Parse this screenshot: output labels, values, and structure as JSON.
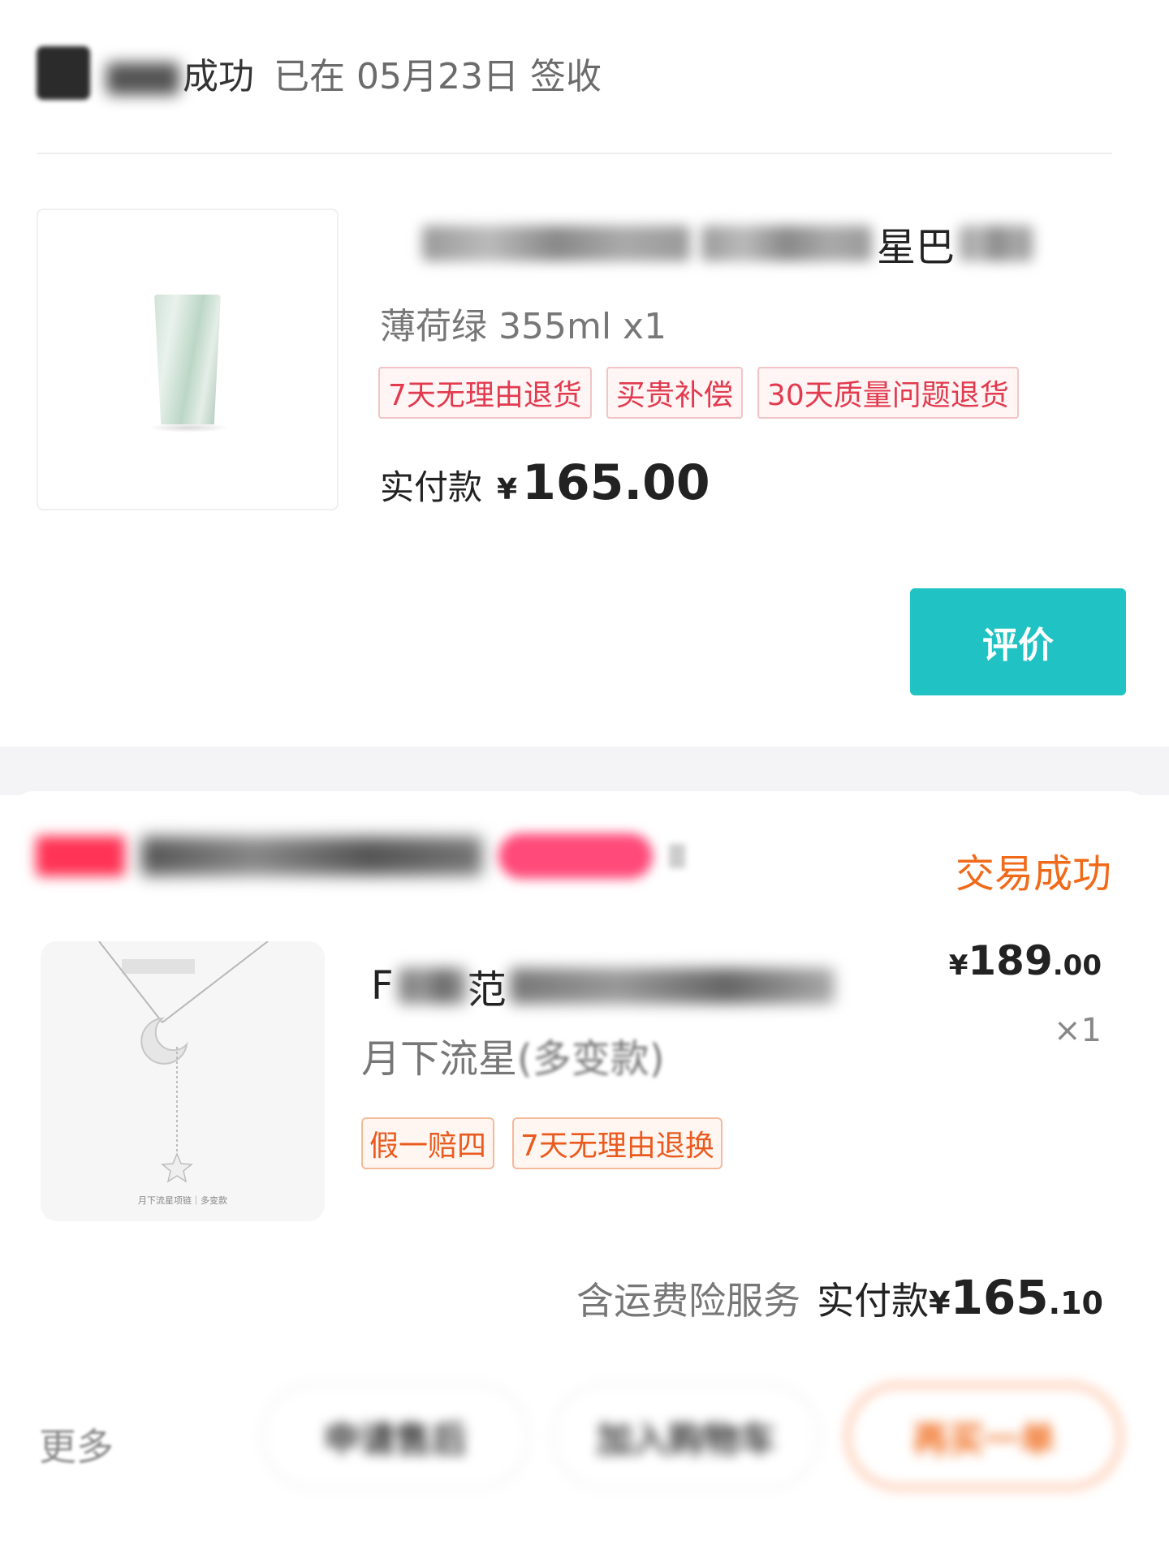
{
  "order1": {
    "status_blurred": "交易",
    "status": "成功",
    "sign_text": "已在 05月23日 签收",
    "title_visible": "星巴",
    "spec": "薄荷绿 355ml x1",
    "tags": [
      "7天无理由退货",
      "买贵补偿",
      "30天质量问题退货"
    ],
    "paid_label": "实付款",
    "currency": "¥",
    "paid_amount": "165.00",
    "review_button": "评价"
  },
  "order2": {
    "status": "交易成功",
    "title_visible_a": "F",
    "title_visible_b": "范",
    "price_currency": "¥",
    "price_int": "189",
    "price_dec": ".00",
    "qty": "×1",
    "spec_a": "月下流星",
    "spec_b": "(多变款)",
    "tags": [
      "假一赔四",
      "7天无理由退换"
    ],
    "thumb_caption": "月下流星项链｜多变款",
    "insurance_text": "含运费险服务",
    "paid_label": "实付款",
    "currency": "¥",
    "paid_int": "165",
    "paid_dec": ".10",
    "more_label": "更多",
    "actions": [
      "申请售后",
      "加入购物车",
      "再买一单"
    ]
  },
  "colors": {
    "accent_teal": "#20c2c3",
    "status_orange": "#f06a1a",
    "tag_red": "#e23a4e",
    "tag_orange": "#ea5a1e"
  }
}
